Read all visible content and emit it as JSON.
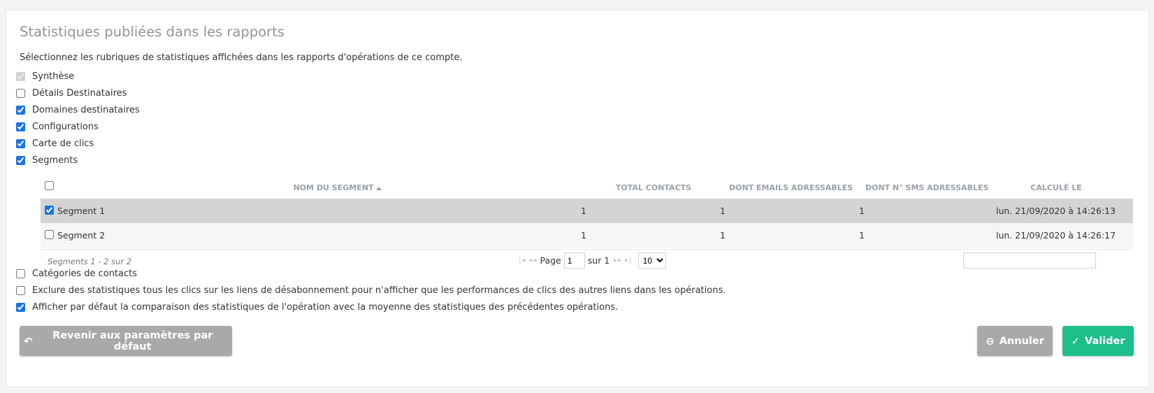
{
  "page": {
    "title": "Statistiques publiées dans les rapports",
    "intro": "Sélectionnez les rubriques de statistiques affichées dans les rapports d'opérations de ce compte."
  },
  "options_top": [
    {
      "label": "Synthèse",
      "checked": true,
      "disabled": true
    },
    {
      "label": "Détails Destinataires",
      "checked": false,
      "disabled": false
    },
    {
      "label": "Domaines destinataires",
      "checked": true,
      "disabled": false
    },
    {
      "label": "Configurations",
      "checked": true,
      "disabled": false
    },
    {
      "label": "Carte de clics",
      "checked": true,
      "disabled": false
    },
    {
      "label": "Segments",
      "checked": true,
      "disabled": false
    }
  ],
  "segments_grid": {
    "columns": [
      "NOM DU SEGMENT",
      "TOTAL CONTACTS",
      "DONT EMAILS ADRESSABLES",
      "DONT N° SMS ADRESSABLES",
      "CALCULÉ LE"
    ],
    "rows": [
      {
        "name": "Segment 1",
        "total": "1",
        "emails": "1",
        "sms": "1",
        "computed": "lun. 21/09/2020 à 14:26:13",
        "checked": true
      },
      {
        "name": "Segment 2",
        "total": "1",
        "emails": "1",
        "sms": "1",
        "computed": "lun. 21/09/2020 à 14:26:17",
        "checked": false
      }
    ],
    "pager": {
      "info": "Segments 1 - 2 sur 2",
      "page_label": "Page",
      "page_value": "1",
      "of_label": "sur 1",
      "page_size": "10"
    }
  },
  "options_bottom": [
    {
      "label": "Catégories de contacts",
      "checked": false
    },
    {
      "label": "Exclure des statistiques tous les clics sur les liens de désabonnement pour n'afficher que les performances de clics des autres liens dans les opérations.",
      "checked": false
    },
    {
      "label": "Afficher par défaut la comparaison des statistiques de l'opération avec la moyenne des statistiques des précédentes opérations.",
      "checked": true
    }
  ],
  "buttons": {
    "reset": "Revenir aux paramètres par défaut",
    "cancel": "Annuler",
    "ok": "Valider"
  },
  "icons": {
    "reset": "undo-arrow-icon",
    "cancel": "minus-circle-icon",
    "ok": "check-icon"
  },
  "colors": {
    "accent": "#1a73e8",
    "ok_button": "#1dbf8a",
    "neutral_button": "#a9a9a9"
  }
}
